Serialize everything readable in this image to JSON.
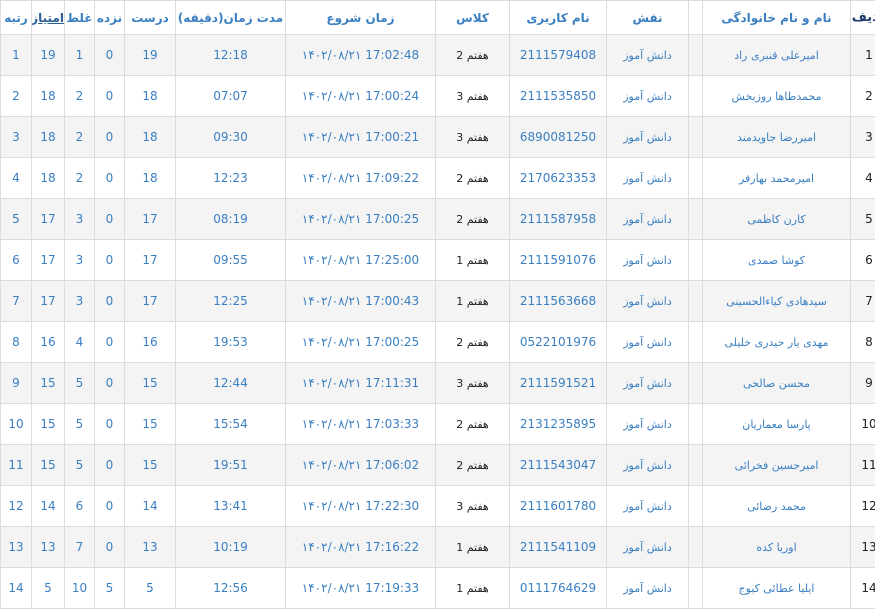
{
  "table": {
    "headers": {
      "row_num": "ردیف",
      "full_name": "نام و نام خانوادگی",
      "blank": "",
      "role": "نقش",
      "username": "نام کاربری",
      "class": "کلاس",
      "start_time": "زمان شروع",
      "duration": "مدت زمان(دقیقه)",
      "correct": "درست",
      "unanswered": "نزده",
      "wrong": "غلط",
      "score": "امتیاز",
      "rank": "رتبه"
    },
    "rows": [
      {
        "row_num": "1",
        "full_name": "امیرعلی قنبری راد",
        "role": "دانش آموز",
        "username": "2111579408",
        "class": "هفتم 2",
        "start_time": "17:02:48 ۱۴۰۲/۰۸/۲۱",
        "duration": "12:18",
        "correct": "19",
        "unanswered": "0",
        "wrong": "1",
        "score": "19",
        "rank": "1"
      },
      {
        "row_num": "2",
        "full_name": "محمدطاها روزبخش",
        "role": "دانش آموز",
        "username": "2111535850",
        "class": "هفتم 3",
        "start_time": "17:00:24 ۱۴۰۲/۰۸/۲۱",
        "duration": "07:07",
        "correct": "18",
        "unanswered": "0",
        "wrong": "2",
        "score": "18",
        "rank": "2"
      },
      {
        "row_num": "3",
        "full_name": "امیررضا جاویدمند",
        "role": "دانش آموز",
        "username": "6890081250",
        "class": "هفتم 3",
        "start_time": "17:00:21 ۱۴۰۲/۰۸/۲۱",
        "duration": "09:30",
        "correct": "18",
        "unanswered": "0",
        "wrong": "2",
        "score": "18",
        "rank": "3"
      },
      {
        "row_num": "4",
        "full_name": "امیرمحمد بهارفر",
        "role": "دانش آموز",
        "username": "2170623353",
        "class": "هفتم 2",
        "start_time": "17:09:22 ۱۴۰۲/۰۸/۲۱",
        "duration": "12:23",
        "correct": "18",
        "unanswered": "0",
        "wrong": "2",
        "score": "18",
        "rank": "4"
      },
      {
        "row_num": "5",
        "full_name": "کارن کاظمی",
        "role": "دانش آموز",
        "username": "2111587958",
        "class": "هفتم 2",
        "start_time": "17:00:25 ۱۴۰۲/۰۸/۲۱",
        "duration": "08:19",
        "correct": "17",
        "unanswered": "0",
        "wrong": "3",
        "score": "17",
        "rank": "5"
      },
      {
        "row_num": "6",
        "full_name": "کوشا صمدی",
        "role": "دانش آموز",
        "username": "2111591076",
        "class": "هفتم 1",
        "start_time": "17:25:00 ۱۴۰۲/۰۸/۲۱",
        "duration": "09:55",
        "correct": "17",
        "unanswered": "0",
        "wrong": "3",
        "score": "17",
        "rank": "6"
      },
      {
        "row_num": "7",
        "full_name": "سیدهادی کیاءالحسینی",
        "role": "دانش آموز",
        "username": "2111563668",
        "class": "هفتم 1",
        "start_time": "17:00:43 ۱۴۰۲/۰۸/۲۱",
        "duration": "12:25",
        "correct": "17",
        "unanswered": "0",
        "wrong": "3",
        "score": "17",
        "rank": "7"
      },
      {
        "row_num": "8",
        "full_name": "مهدی یار حیدری خلیلی",
        "role": "دانش آموز",
        "username": "0522101976",
        "class": "هفتم 2",
        "start_time": "17:00:25 ۱۴۰۲/۰۸/۲۱",
        "duration": "19:53",
        "correct": "16",
        "unanswered": "0",
        "wrong": "4",
        "score": "16",
        "rank": "8"
      },
      {
        "row_num": "9",
        "full_name": "محسن صالحی",
        "role": "دانش آموز",
        "username": "2111591521",
        "class": "هفتم 3",
        "start_time": "17:11:31 ۱۴۰۲/۰۸/۲۱",
        "duration": "12:44",
        "correct": "15",
        "unanswered": "0",
        "wrong": "5",
        "score": "15",
        "rank": "9"
      },
      {
        "row_num": "10",
        "full_name": "پارسا معماریان",
        "role": "دانش آموز",
        "username": "2131235895",
        "class": "هفتم 2",
        "start_time": "17:03:33 ۱۴۰۲/۰۸/۲۱",
        "duration": "15:54",
        "correct": "15",
        "unanswered": "0",
        "wrong": "5",
        "score": "15",
        "rank": "10"
      },
      {
        "row_num": "11",
        "full_name": "امیرحسین فخرائی",
        "role": "دانش آموز",
        "username": "2111543047",
        "class": "هفتم 2",
        "start_time": "17:06:02 ۱۴۰۲/۰۸/۲۱",
        "duration": "19:51",
        "correct": "15",
        "unanswered": "0",
        "wrong": "5",
        "score": "15",
        "rank": "11"
      },
      {
        "row_num": "12",
        "full_name": "محمد رضائی",
        "role": "دانش آموز",
        "username": "2111601780",
        "class": "هفتم 3",
        "start_time": "17:22:30 ۱۴۰۲/۰۸/۲۱",
        "duration": "13:41",
        "correct": "14",
        "unanswered": "0",
        "wrong": "6",
        "score": "14",
        "rank": "12"
      },
      {
        "row_num": "13",
        "full_name": "اوریا کده",
        "role": "دانش آموز",
        "username": "2111541109",
        "class": "هفتم 1",
        "start_time": "17:16:22 ۱۴۰۲/۰۸/۲۱",
        "duration": "10:19",
        "correct": "13",
        "unanswered": "0",
        "wrong": "7",
        "score": "13",
        "rank": "13"
      },
      {
        "row_num": "14",
        "full_name": "ایلیا عطائی کیوج",
        "role": "دانش آموز",
        "username": "0111764629",
        "class": "هفتم 1",
        "start_time": "17:19:33 ۱۴۰۲/۰۸/۲۱",
        "duration": "12:56",
        "correct": "5",
        "unanswered": "5",
        "wrong": "10",
        "score": "5",
        "rank": "14"
      }
    ]
  }
}
